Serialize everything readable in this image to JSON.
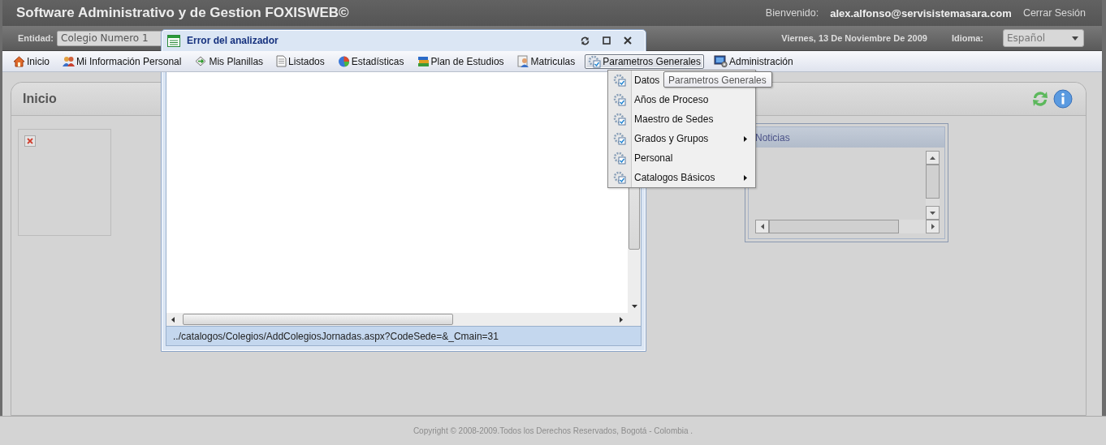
{
  "app_title": "Software Administrativo y de Gestion FOXISWEB©",
  "session": {
    "welcome_label": "Bienvenido:",
    "user": "alex.alfonso@servisistemasara.com",
    "logout": "Cerrar Sesión"
  },
  "toolbar": {
    "entity_label": "Entidad:",
    "entity_value": "Colegio Numero 1",
    "date": "Viernes, 13 De Noviembre De 2009",
    "language_label": "Idioma:",
    "language_value": "Español"
  },
  "menu": [
    {
      "label": "Inicio",
      "kind": "home",
      "selected": false
    },
    {
      "label": "Mi Información Personal",
      "kind": "people",
      "selected": false
    },
    {
      "label": "Mis Planillas",
      "kind": "diamond",
      "selected": false
    },
    {
      "label": "Listados",
      "kind": "document",
      "selected": false
    },
    {
      "label": "Estadísticas",
      "kind": "chart",
      "selected": false
    },
    {
      "label": "Plan de Estudios",
      "kind": "books",
      "selected": false
    },
    {
      "label": "Matriculas",
      "kind": "person",
      "selected": false
    },
    {
      "label": "Parametros Generales",
      "kind": "gear",
      "selected": true
    },
    {
      "label": "Administración",
      "kind": "monitor",
      "selected": false
    }
  ],
  "dropdown": {
    "items": [
      {
        "label": "Datos"
      },
      {
        "label": "Años de Proceso",
        "has_submenu": false
      },
      {
        "label": "Maestro de Sedes",
        "has_submenu": false
      },
      {
        "label": "Grados y Grupos",
        "has_submenu": true
      },
      {
        "label": "Personal",
        "has_submenu": false
      },
      {
        "label": "Catalogos Básicos",
        "has_submenu": true
      }
    ],
    "tooltip": "Parametros Generales"
  },
  "panel": {
    "title": "Inicio",
    "news": {
      "title": "Noticias"
    }
  },
  "dialog": {
    "title": "Error del analizador",
    "status": "../catalogos/Colegios/AddColegiosJornadas.aspx?CodeSede=&_Cmain=31"
  },
  "footer": "Copyright © 2008-2009.Todos los Derechos Reservados, Bogotá - Colombia ."
}
